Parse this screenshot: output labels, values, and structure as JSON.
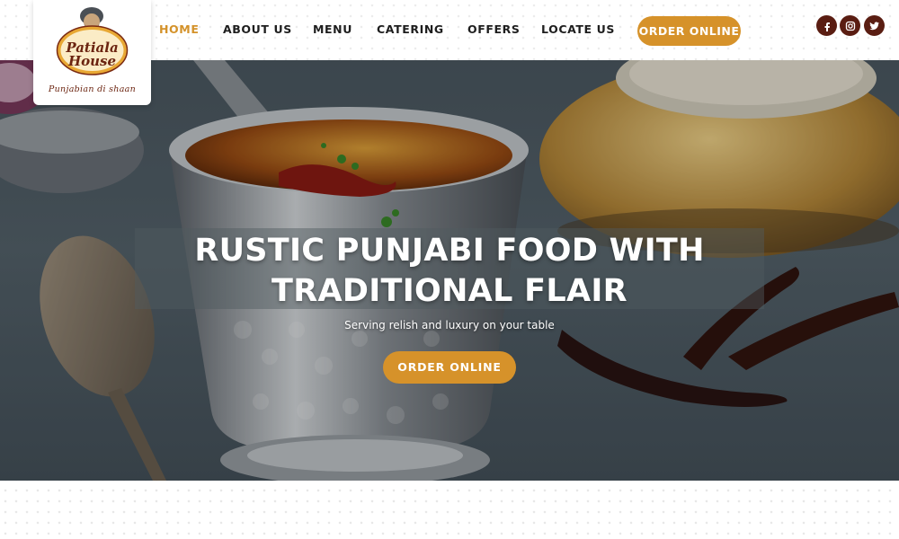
{
  "brand": {
    "name_line1": "Patiala",
    "name_line2": "House",
    "tagline": "Punjabian di shaan"
  },
  "nav": {
    "items": [
      {
        "label": "HOME",
        "active": true
      },
      {
        "label": "ABOUT US",
        "active": false
      },
      {
        "label": "MENU",
        "active": false
      },
      {
        "label": "CATERING",
        "active": false
      },
      {
        "label": "OFFERS",
        "active": false
      },
      {
        "label": "LOCATE US",
        "active": false
      }
    ],
    "order_button": "ORDER ONLINE"
  },
  "social": [
    "facebook-icon",
    "instagram-icon",
    "twitter-icon"
  ],
  "hero": {
    "title": "RUSTIC PUNJABI FOOD WITH TRADITIONAL FLAIR",
    "subtitle": "Serving relish and luxury on your table",
    "button": "ORDER ONLINE"
  },
  "colors": {
    "accent": "#d6922a",
    "active_nav": "#d4922a",
    "social_bg": "#5a1d12",
    "brand_text": "#6b2410"
  }
}
